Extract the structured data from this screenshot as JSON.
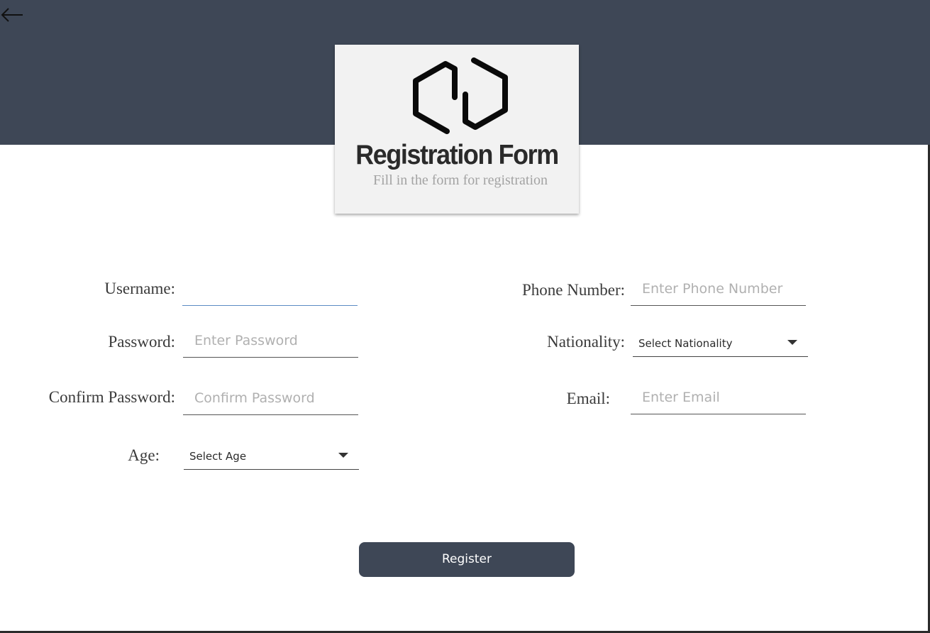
{
  "header": {
    "back_icon": "arrow-left-icon",
    "logo_icon": "hexagon-link-logo",
    "title": "Registration Form",
    "subtitle": "Fill in the form for registration"
  },
  "form": {
    "username": {
      "label": "Username:",
      "value": "",
      "placeholder": ""
    },
    "password": {
      "label": "Password:",
      "value": "",
      "placeholder": "Enter Password"
    },
    "confirm_password": {
      "label": "Confirm Password:",
      "value": "",
      "placeholder": "Confirm Password"
    },
    "age": {
      "label": "Age:",
      "selected": "Select Age"
    },
    "phone": {
      "label": "Phone Number:",
      "value": "",
      "placeholder": "Enter Phone Number"
    },
    "nationality": {
      "label": "Nationality:",
      "selected": "Select Nationality"
    },
    "email": {
      "label": "Email:",
      "value": "",
      "placeholder": "Enter Email"
    }
  },
  "actions": {
    "register_label": "Register"
  },
  "colors": {
    "header_band": "#3e4756",
    "button": "#3e4756",
    "card": "#f2f2f2",
    "focus_underline": "#5b8bc4"
  }
}
